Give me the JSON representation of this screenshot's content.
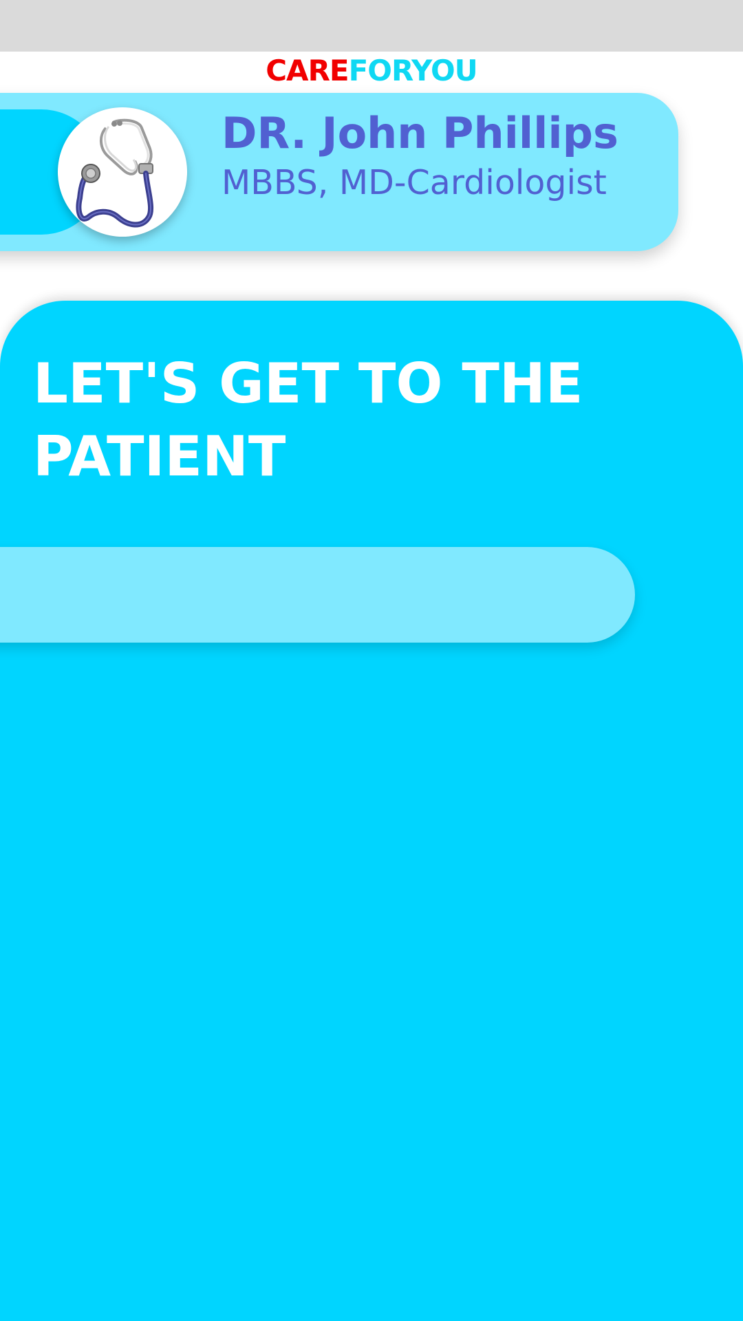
{
  "brand": {
    "part1": "CARE",
    "part2": "FORYOU",
    "part1_color": "#f10000",
    "part2_color": "#0fd8f3"
  },
  "doctor": {
    "name": "DR. John Phillips",
    "degree": "MBBS, MD-Cardiologist",
    "avatar_icon": "stethoscope-icon"
  },
  "main": {
    "headline": "LET'S GET TO THE PATIENT"
  },
  "colors": {
    "accent": "#00d5ff",
    "light_accent": "#80e9ff",
    "text_primary": "#5160d1",
    "status_bar": "#dadada"
  }
}
